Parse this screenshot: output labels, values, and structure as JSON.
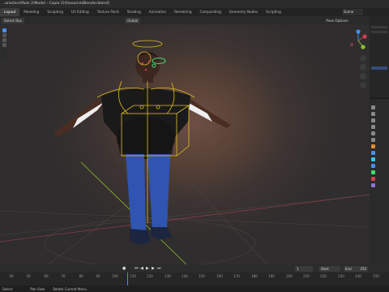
{
  "window": {
    "title": "...aracters\\Pack 2\\Model - Copie (14)\\source\\Blender.blend]"
  },
  "workspaces": {
    "tabs": [
      "Layout",
      "Modeling",
      "Sculpting",
      "UV Editing",
      "Texture Paint",
      "Shading",
      "Animation",
      "Rendering",
      "Compositing",
      "Geometry Nodes",
      "Scripting"
    ],
    "active": "Layout",
    "scene_label": "Scene"
  },
  "viewport_header": {
    "select_box": "Select Box",
    "transform_orientation": "Global",
    "pose_options": "Pose Options"
  },
  "timeline": {
    "frame_ticks": [
      "40",
      "50",
      "60",
      "70",
      "80",
      "90",
      "100",
      "110",
      "120",
      "130",
      "140",
      "150",
      "160",
      "170",
      "180",
      "190",
      "200",
      "210",
      "220",
      "230",
      "240",
      "250"
    ],
    "current_frame": "1",
    "start_label": "Start",
    "start_value": "1",
    "end_label": "End",
    "end_value": "250"
  },
  "statusbar": {
    "items": [
      "Select",
      "Pan View",
      "Rotate Current Menu"
    ]
  },
  "colors": {
    "accent_blue": "#4a8df0",
    "bone_yellow": "#e0c020",
    "bone_green": "#40e070",
    "axis_red": "#d04050",
    "axis_green": "#8ac030"
  },
  "icons": [
    "cursor-icon",
    "gizmo-x-icon",
    "gizmo-y-icon",
    "gizmo-z-icon",
    "zoom-icon",
    "hand-icon",
    "camera-icon",
    "grid-icon",
    "play-icon",
    "jump-start-icon",
    "jump-end-icon",
    "step-back-icon",
    "step-forward-icon"
  ]
}
